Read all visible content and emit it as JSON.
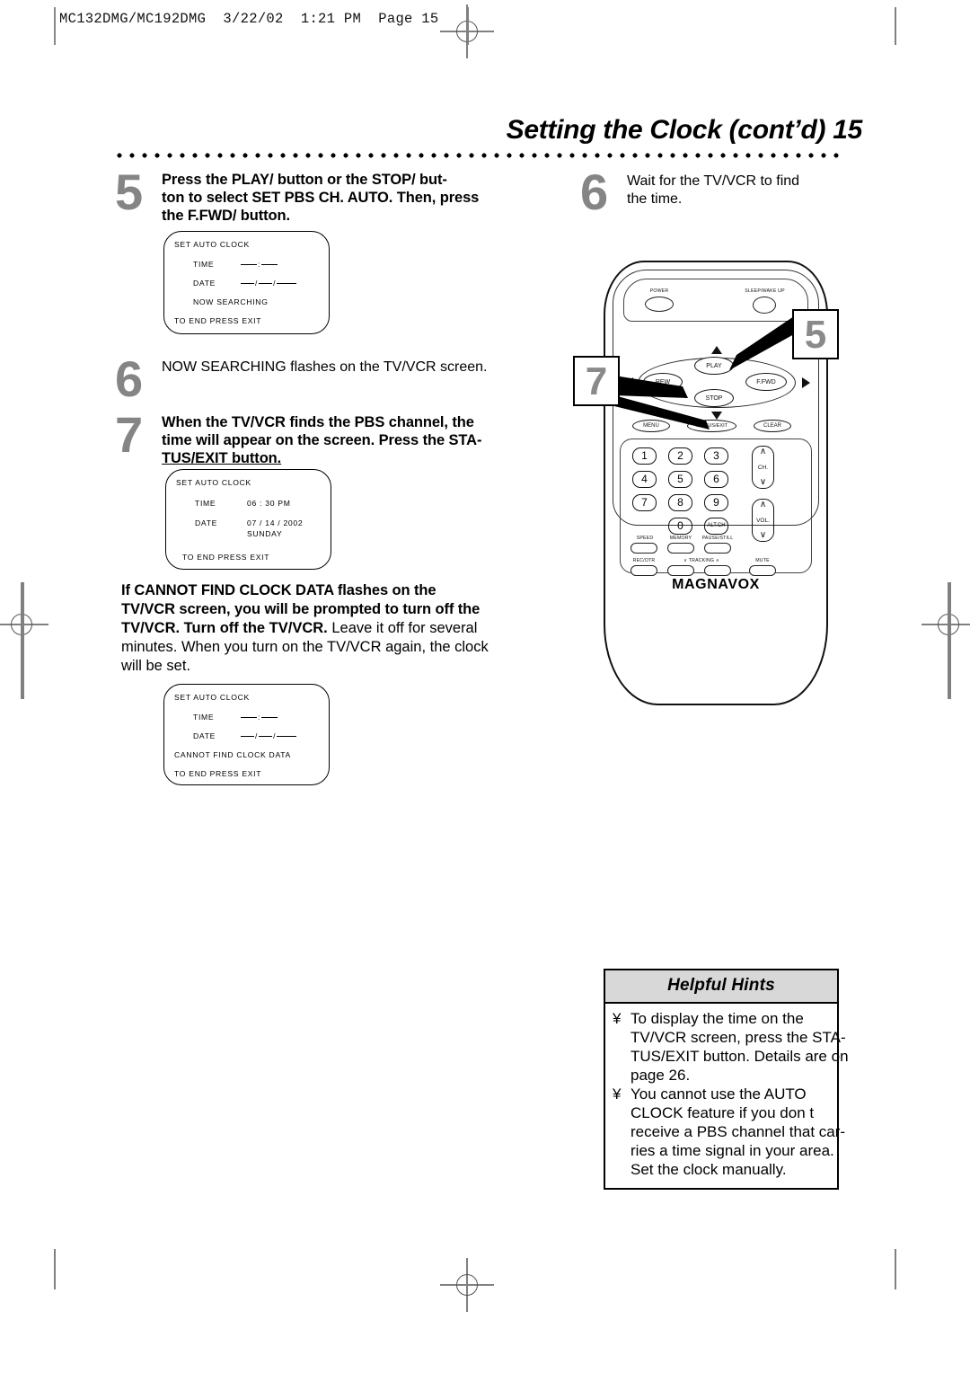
{
  "page": {
    "header_line": "MC132DMG/MC192DMG  3/22/02  1:21 PM  Page 15",
    "title": "Setting the Clock (cont’d)  15"
  },
  "left_column": {
    "step5": {
      "number": "5",
      "lines": [
        "Press the PLAY/    button or the STOP/    but-",
        "ton to select SET PBS CH. AUTO. Then, press",
        "the F.FWD/    button."
      ]
    },
    "screen1": {
      "title": "SET AUTO CLOCK",
      "time_label": "TIME",
      "date_label": "DATE",
      "status": "NOW SEARCHING",
      "footer": "TO END PRESS EXIT"
    },
    "step6": {
      "number": "6",
      "lines": [
        "NOW SEARCHING flashes on the TV/VCR screen."
      ]
    },
    "step7": {
      "number": "7",
      "lines": [
        "When the TV/VCR finds the PBS channel, the",
        "time will appear on the screen. Press the STA-",
        "TUS/EXIT button."
      ]
    },
    "screen2": {
      "title": "SET AUTO CLOCK",
      "time_label": "TIME",
      "time_value": "06 : 30 PM",
      "date_label": "DATE",
      "date_value": "07 / 14 / 2002",
      "day_value": "SUNDAY",
      "footer": "TO END PRESS EXIT"
    },
    "note": {
      "bold_lines": [
        "If CANNOT FIND CLOCK DATA flashes on the",
        "TV/VCR screen, you will be prompted to turn off the",
        "TV/VCR. Turn off the TV/VCR."
      ],
      "plain_tail": " Leave it off for several",
      "plain_lines": [
        "minutes. When you turn on the TV/VCR again, the clock",
        "will be set."
      ]
    },
    "screen3": {
      "title": "SET AUTO CLOCK",
      "time_label": "TIME",
      "date_label": "DATE",
      "status": "CANNOT FIND CLOCK DATA",
      "footer": "TO END PRESS EXIT"
    }
  },
  "right_column": {
    "step6": {
      "number": "6",
      "lines": [
        "Wait for the TV/VCR to find",
        "the time."
      ]
    },
    "callouts": {
      "seven": "7",
      "five": "5"
    },
    "remote": {
      "brand": "MAGNAVOX",
      "power": "POWER",
      "sleep": "SLEEP/WAKE UP",
      "play": "PLAY",
      "rew": "REW",
      "ffwd": "F.FWD",
      "stop": "STOP",
      "menu": "MENU",
      "status_exit": "STATUS/EXIT",
      "clear": "CLEAR",
      "keys": [
        "1",
        "2",
        "3",
        "4",
        "5",
        "6",
        "7",
        "8",
        "9"
      ],
      "zero": "0",
      "alt_ch": "ALT.CH",
      "ch_rocker": "CH.",
      "vol_rocker": "VOL.",
      "speed": "SPEED",
      "memory": "MEMORY",
      "pause_still": "PAUSE/STILL",
      "rec_otr": "REC/OTR",
      "tracking": "TRACKING",
      "mute": "MUTE"
    }
  },
  "hints": {
    "heading": "Helpful Hints",
    "bullet_glyph": "¥",
    "items": [
      [
        "To display the time on the",
        "TV/VCR screen, press the STA-",
        "TUS/EXIT button. Details are on",
        "page 26."
      ],
      [
        "You cannot use the AUTO",
        "CLOCK feature if you don t",
        "receive a PBS channel that car-",
        "ries a time signal in your area.",
        "Set the clock manually."
      ]
    ]
  },
  "colors": {
    "step_number_gray": "#858585",
    "hints_header_bg": "#d8d8d8",
    "reg_mark_gray": "#808080"
  }
}
